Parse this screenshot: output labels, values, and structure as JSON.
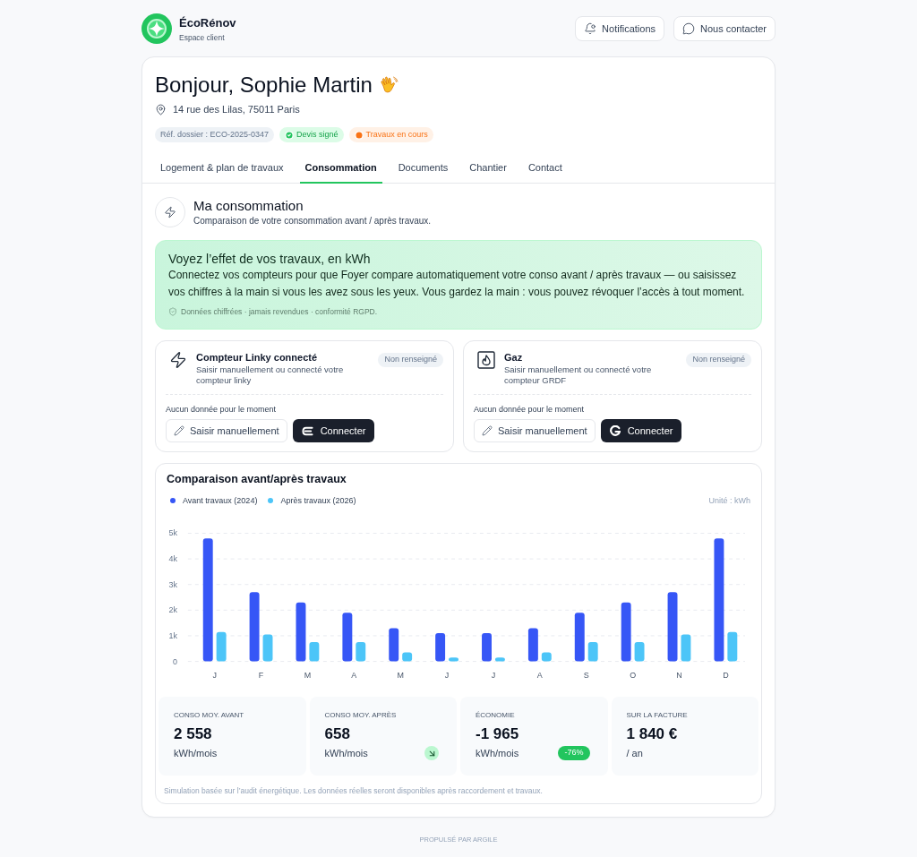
{
  "header": {
    "brand": "ÉcoRénov",
    "subtitle": "Espace client",
    "actions": [
      {
        "label": "Notifications"
      },
      {
        "label": "Nous contacter"
      }
    ]
  },
  "profile": {
    "greeting": "Bonjour, Sophie Martin",
    "address": "14 rue des Lilas, 75011 Paris",
    "badges": [
      {
        "label": "Réf. dossier : ECO-2025-0347",
        "kind": "neutral"
      },
      {
        "label": "Devis signé",
        "kind": "success"
      },
      {
        "label": "Travaux en cours",
        "kind": "progress"
      }
    ]
  },
  "tabs": [
    {
      "label": "Logement & plan de travaux",
      "selected": false
    },
    {
      "label": "Consommation",
      "selected": true
    },
    {
      "label": "Documents",
      "selected": false
    },
    {
      "label": "Chantier",
      "selected": false
    },
    {
      "label": "Contact",
      "selected": false
    }
  ],
  "section": {
    "title": "Ma consommation",
    "subtitle": "Comparaison de votre consommation avant / après travaux."
  },
  "banner": {
    "title": "Voyez l’effet de vos travaux, en kWh",
    "text": "Connectez vos compteurs pour que Foyer compare automatiquement votre conso avant / après travaux — ou saisissez vos chiffres à la main si vous les avez sous les yeux. Vous gardez la main : vous pouvez révoquer l’accès à tout moment.",
    "note": "Données chiffrées · jamais revendues · conformité RGPD."
  },
  "meters": [
    {
      "kind": "electricity",
      "title": "Compteur Linky connecté",
      "description": "Saisir manuellement ou connecté votre compteur linky",
      "status": "Non renseigné",
      "empty_text": "Aucun donnée pour le moment",
      "manual_button": "Saisir manuellement",
      "connect_button": "Connecter"
    },
    {
      "kind": "gas",
      "title": "Gaz",
      "description": "Saisir manuellement ou connecté votre compteur GRDF",
      "status": "Non renseigné",
      "empty_text": "Aucun donnée pour le moment",
      "manual_button": "Saisir manuellement",
      "connect_button": "Connecter"
    }
  ],
  "chart": {
    "title": "Comparaison avant/après travaux",
    "unit": "Unité : kWh",
    "chart_data": {
      "type": "bar",
      "grid": true,
      "categories": [
        "J",
        "F",
        "M",
        "A",
        "M",
        "J",
        "J",
        "A",
        "S",
        "O",
        "N",
        "D"
      ],
      "series": [
        {
          "name": "Avant travaux (2024)",
          "color": "#3656f6",
          "values": [
            4800,
            2700,
            2300,
            1900,
            1300,
            1100,
            1100,
            1300,
            1900,
            2300,
            2700,
            4800
          ]
        },
        {
          "name": "Après travaux (2026)",
          "color": "#4cc5f8",
          "values": [
            1150,
            1050,
            750,
            750,
            350,
            150,
            150,
            350,
            750,
            750,
            1050,
            1150
          ]
        }
      ],
      "ylim": [
        0,
        5000
      ],
      "yticks": [
        {
          "value": 0,
          "label": "0"
        },
        {
          "value": 1000,
          "label": "1k"
        },
        {
          "value": 2000,
          "label": "2k"
        },
        {
          "value": 3000,
          "label": "3k"
        },
        {
          "value": 4000,
          "label": "4k"
        },
        {
          "value": 5000,
          "label": "5k"
        }
      ]
    }
  },
  "stats": [
    {
      "kind": "plain",
      "label": "CONSO MOY. AVANT",
      "value": "2 558",
      "unit": "kWh/mois"
    },
    {
      "kind": "trend",
      "label": "CONSO MOY. APRÈS",
      "value": "658",
      "unit": "kWh/mois"
    },
    {
      "kind": "badge",
      "label": "ÉCONOMIE",
      "value": "-1 965",
      "unit": "kWh/mois",
      "badge": "-76%"
    },
    {
      "kind": "plain",
      "label": "SUR LA FACTURE",
      "value": "1 840 €",
      "unit": "/ an"
    }
  ],
  "note": "Simulation basée sur l’audit énergétique. Les données réelles seront disponibles après raccordement et travaux.",
  "footer": "PROPULSÉ PAR ARGILE"
}
